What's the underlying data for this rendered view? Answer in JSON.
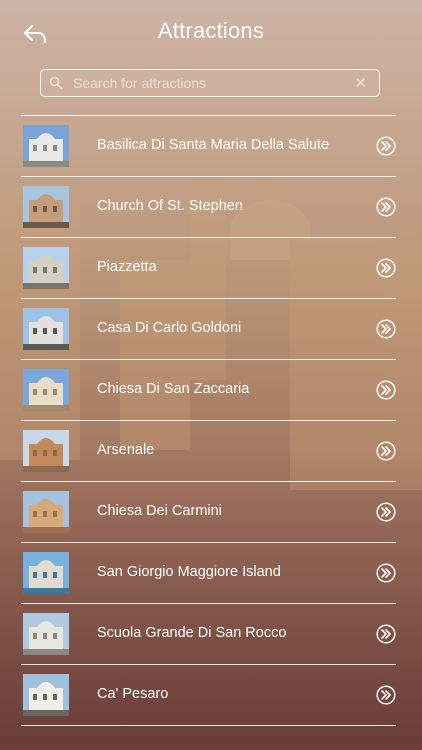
{
  "header": {
    "title": "Attractions",
    "back_icon": "back-arrow-icon"
  },
  "search": {
    "placeholder": "Search for attractions",
    "value": "",
    "search_icon": "search-icon",
    "clear_icon": "close-icon"
  },
  "attractions": [
    {
      "label": "Basilica Di Santa Maria Della Salute",
      "thumb_colors": [
        "#7aa3d8",
        "#e8e8e6",
        "#8a8b86"
      ]
    },
    {
      "label": "Church Of St. Stephen",
      "thumb_colors": [
        "#a9c4e0",
        "#c69d7a",
        "#6a5a48"
      ]
    },
    {
      "label": "Piazzetta",
      "thumb_colors": [
        "#b8d1ec",
        "#d4d0c6",
        "#7a766c"
      ]
    },
    {
      "label": "Casa Di Carlo Goldoni",
      "thumb_colors": [
        "#9ec1e6",
        "#e3e1dc",
        "#5a5a56"
      ]
    },
    {
      "label": "Chiesa Di San Zaccaria",
      "thumb_colors": [
        "#7aa8dc",
        "#e8ddc8",
        "#a08a6a"
      ]
    },
    {
      "label": "Arsenale",
      "thumb_colors": [
        "#c8d8e8",
        "#c48a5a",
        "#8a6a50"
      ]
    },
    {
      "label": "Chiesa Dei Carmini",
      "thumb_colors": [
        "#a5c2e0",
        "#d8a878",
        "#9a7050"
      ]
    },
    {
      "label": "San Giorgio Maggiore Island",
      "thumb_colors": [
        "#7ab0e0",
        "#e2dcd0",
        "#3e7aa0"
      ]
    },
    {
      "label": "Scuola Grande Di San Rocco",
      "thumb_colors": [
        "#b0c8e0",
        "#e8e6e0",
        "#8a8884"
      ]
    },
    {
      "label": "Ca' Pesaro",
      "thumb_colors": [
        "#a0c0e0",
        "#f0eee8",
        "#6a6660"
      ]
    }
  ],
  "row_action_icon": "double-chevron-right-circle-icon",
  "colors": {
    "text": "#ffffff",
    "background_top": "#cdb4a6",
    "background_bottom": "#6d3f3c"
  }
}
